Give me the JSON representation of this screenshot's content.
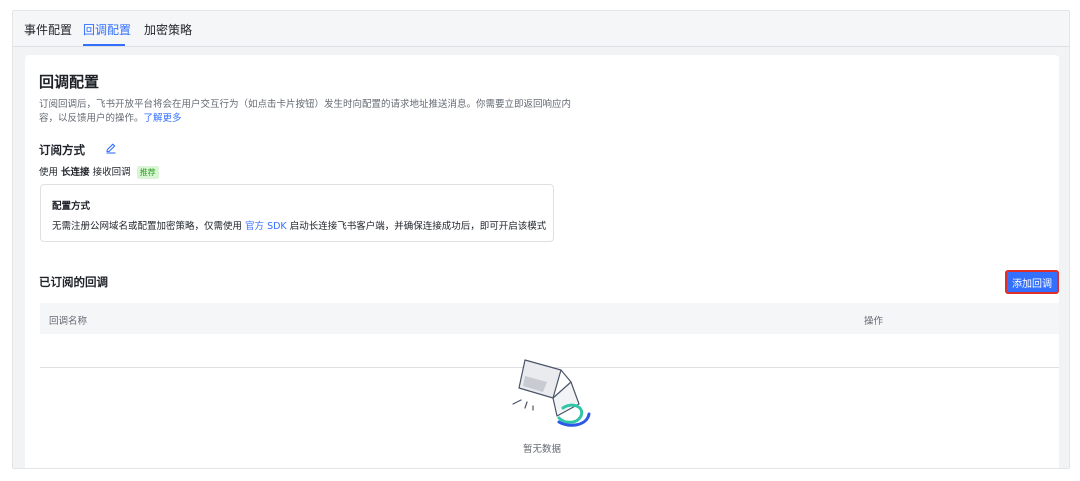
{
  "tabs": [
    {
      "label": "事件配置"
    },
    {
      "label": "回调配置"
    },
    {
      "label": "加密策略"
    }
  ],
  "page": {
    "title": "回调配置",
    "description_line1": "订阅回调后，飞书开放平台将会在用户交互行为（如点击卡片按钮）发生时向配置的请求地址推送消息。你需要立即返回响应内",
    "description_line2": "容，以反馈用户的操作。",
    "learn_more": "了解更多"
  },
  "subscription": {
    "title": "订阅方式",
    "usage_prefix": "使用",
    "usage_mode": "长连接",
    "usage_suffix": "接收回调",
    "badge": "推荐"
  },
  "config_box": {
    "title": "配置方式",
    "text_before": "无需注册公网域名或配置加密策略，仅需使用",
    "sdk_link": "官方 SDK",
    "text_after": "启动长连接飞书客户端，并确保连接成功后，即可开启该模式"
  },
  "subscribed": {
    "title": "已订阅的回调",
    "add_button": "添加回调"
  },
  "table": {
    "columns": [
      "回调名称",
      "操作"
    ],
    "empty_text": "暂无数据"
  },
  "colors": {
    "accent": "#3370ff",
    "highlight_border": "#e22e28",
    "badge_bg": "#d9f5d6",
    "badge_text": "#2ea121"
  }
}
